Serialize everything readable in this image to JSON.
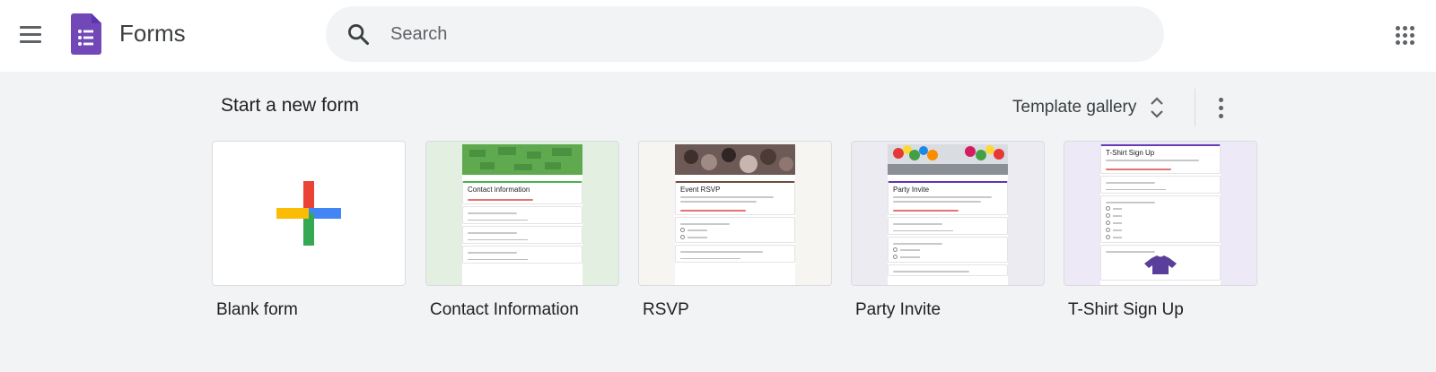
{
  "app": {
    "title": "Forms"
  },
  "search": {
    "placeholder": "Search"
  },
  "section": {
    "title": "Start a new form"
  },
  "gallery": {
    "label": "Template gallery"
  },
  "templates": [
    {
      "label": "Blank form"
    },
    {
      "label": "Contact Information",
      "preview_title": "Contact information",
      "bg": "#e3efe1",
      "accent": "#4caf50"
    },
    {
      "label": "RSVP",
      "preview_title": "Event RSVP",
      "bg": "#f6f5f2",
      "accent": "#6d4c41"
    },
    {
      "label": "Party Invite",
      "preview_title": "Party Invite",
      "bg": "#ecebf1",
      "accent": "#5e35b1"
    },
    {
      "label": "T-Shirt Sign Up",
      "preview_title": "T-Shirt Sign Up",
      "bg": "#eee9f7",
      "accent": "#673ab7"
    }
  ],
  "colors": {
    "forms_purple": "#7248b9",
    "plus_red": "#ea4335",
    "plus_blue": "#4285f4",
    "plus_green": "#34a853",
    "plus_yellow": "#fbbc04"
  }
}
